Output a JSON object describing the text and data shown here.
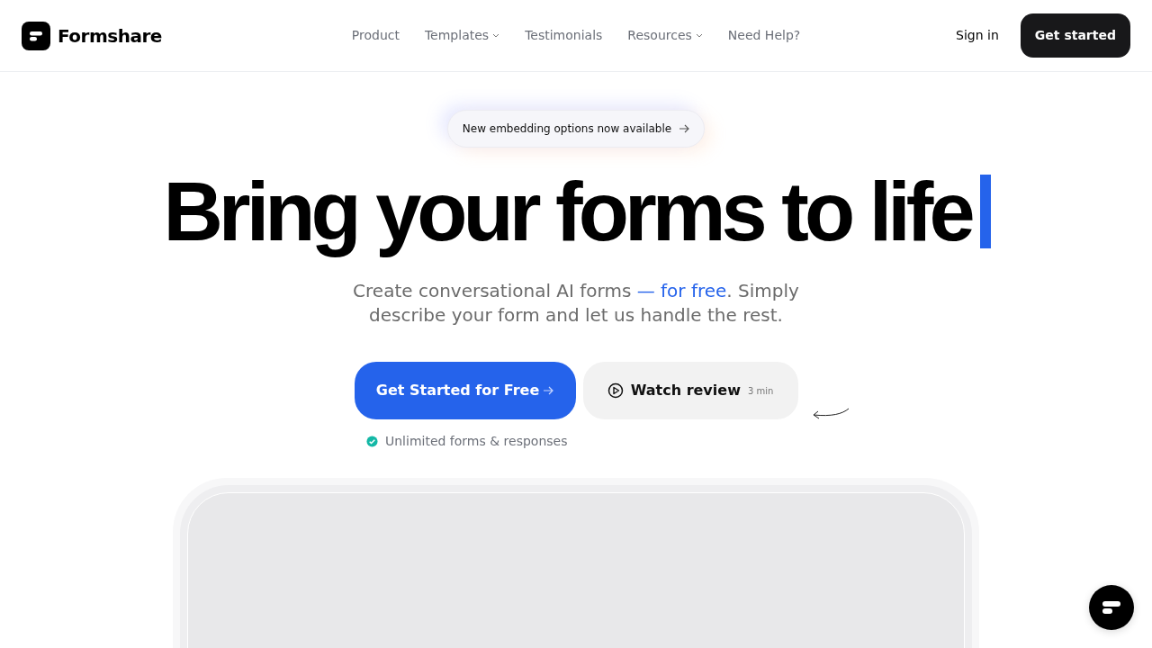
{
  "brand": {
    "name": "Formshare"
  },
  "nav": [
    {
      "label": "Product",
      "has_menu": false
    },
    {
      "label": "Templates",
      "has_menu": true
    },
    {
      "label": "Testimonials",
      "has_menu": false
    },
    {
      "label": "Resources",
      "has_menu": true
    },
    {
      "label": "Need Help?",
      "has_menu": false
    }
  ],
  "sign_in": "Sign in",
  "get_started": "Get started",
  "announcement": "New embedding options now available",
  "headline": "Bring your forms to life",
  "subtitle": {
    "before": "Create conversational AI forms ",
    "highlight": "— for free",
    "after": ". Simply describe your form and let us handle the rest."
  },
  "primary_cta": "Get Started for Free",
  "secondary_cta": {
    "label": "Watch review",
    "duration": "3 min"
  },
  "feature_note": "Unlimited forms & responses"
}
